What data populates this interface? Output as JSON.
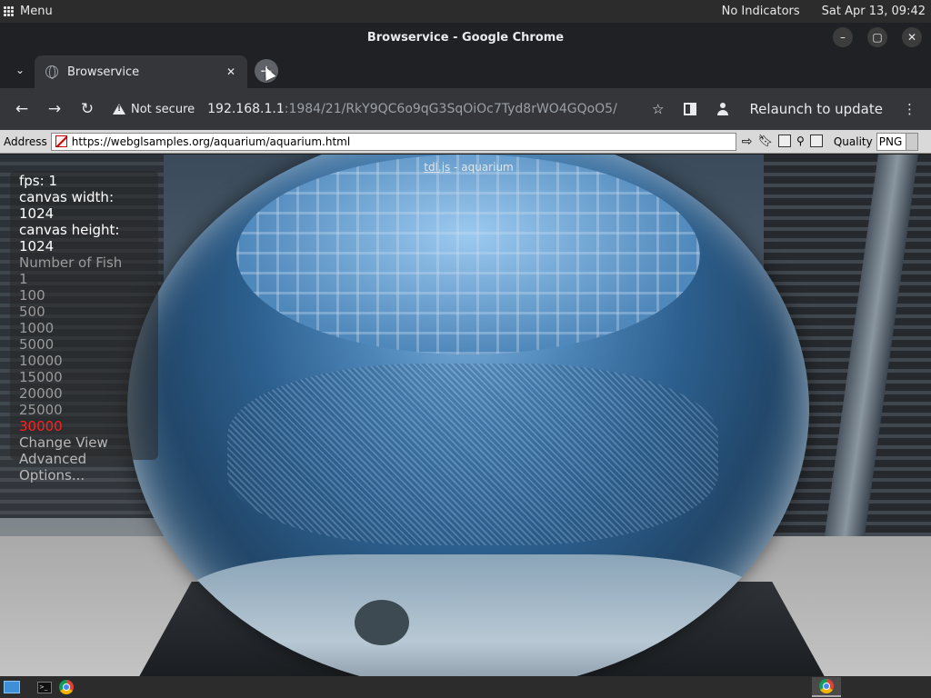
{
  "system_bar": {
    "menu_label": "Menu",
    "indicators": "No Indicators",
    "clock": "Sat Apr 13, 09:42"
  },
  "window": {
    "title": "Browservice - Google Chrome"
  },
  "tabs": [
    {
      "label": "Browservice",
      "active": true
    }
  ],
  "toolbar": {
    "security_label": "Not secure",
    "url_host": "192.168.1.1",
    "url_rest": ":1984/21/RkY9QC6o9qG3SqOiOc7Tyd8rWO4GQoO5/",
    "relaunch_label": "Relaunch to update"
  },
  "remote_bar": {
    "address_label": "Address",
    "address_value": "https://webglsamples.org/aquarium/aquarium.html",
    "quality_label": "Quality",
    "quality_value": "PNG"
  },
  "demo": {
    "title_link": "tdl.js",
    "title_rest": " - aquarium",
    "fps": "fps: 1",
    "canvas_width": "canvas width: 1024",
    "canvas_height": "canvas height: 1024",
    "fish_heading": "Number of Fish",
    "fish_options": [
      "1",
      "100",
      "500",
      "1000",
      "5000",
      "10000",
      "15000",
      "20000",
      "25000",
      "30000"
    ],
    "fish_selected": "30000",
    "menu_items": [
      "Change View",
      "Advanced",
      "Options..."
    ]
  },
  "colors": {
    "selected_option": "#ff2020",
    "chrome_dark": "#202124",
    "toolbar": "#35363a"
  }
}
